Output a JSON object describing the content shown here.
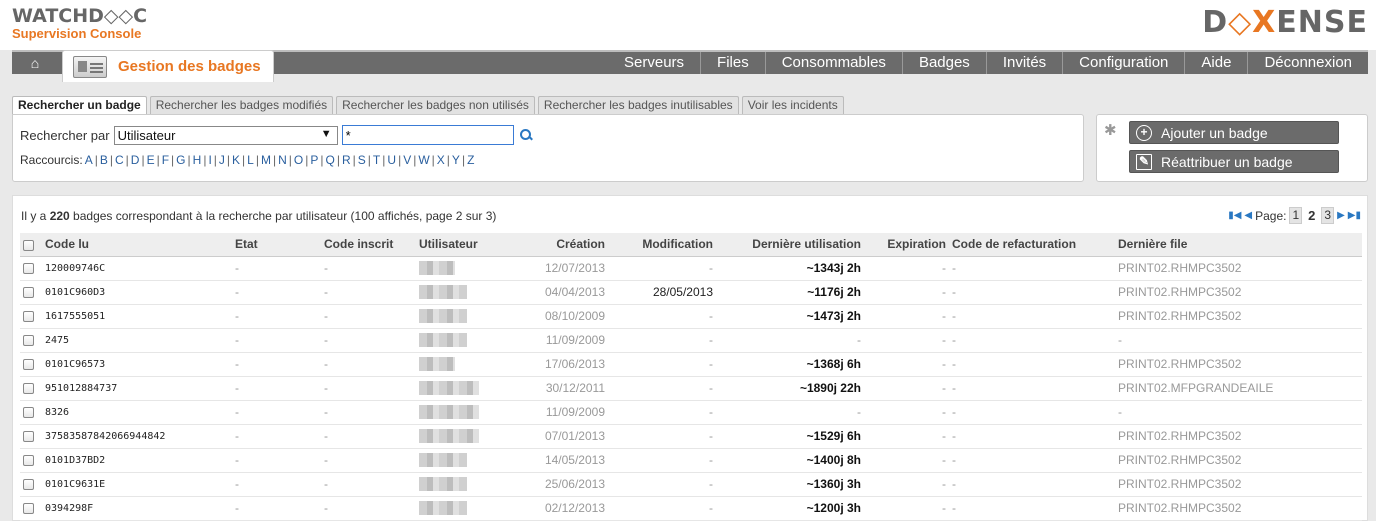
{
  "header": {
    "logo_main": "WATCHD◇◇C",
    "logo_sub": "Supervision Console",
    "brand_pre": "D",
    "brand_accent": "◇X",
    "brand_post": "ENSE"
  },
  "navbar": {
    "home_icon": "home-icon",
    "section_title": "Gestion des badges",
    "menu": [
      "Serveurs",
      "Files",
      "Consommables",
      "Badges",
      "Invités",
      "Configuration",
      "Aide",
      "Déconnexion"
    ]
  },
  "tabs": [
    {
      "label": "Rechercher un badge",
      "active": true
    },
    {
      "label": "Rechercher les badges modifiés",
      "active": false
    },
    {
      "label": "Rechercher les badges non utilisés",
      "active": false
    },
    {
      "label": "Rechercher les badges inutilisables",
      "active": false
    },
    {
      "label": "Voir les incidents",
      "active": false
    }
  ],
  "search": {
    "label": "Rechercher par",
    "select_value": "Utilisateur",
    "input_value": "*",
    "shortcuts_label": "Raccourcis:",
    "letters": [
      "A",
      "B",
      "C",
      "D",
      "E",
      "F",
      "G",
      "H",
      "I",
      "J",
      "K",
      "L",
      "M",
      "N",
      "O",
      "P",
      "Q",
      "R",
      "S",
      "T",
      "U",
      "V",
      "W",
      "X",
      "Y",
      "Z"
    ]
  },
  "actions": {
    "add_badge": "Ajouter un badge",
    "reassign_badge": "Réattribuer un badge"
  },
  "results": {
    "summary_pre": "Il y a ",
    "count": "220",
    "summary_post": " badges correspondant à la recherche par utilisateur (100 affichés, page 2 sur 3)",
    "pager_label": "Page:",
    "pages": [
      "1",
      "2",
      "3"
    ],
    "current_page": "2"
  },
  "table": {
    "headers": [
      "Code lu",
      "Etat",
      "Code inscrit",
      "Utilisateur",
      "Création",
      "Modification",
      "Dernière utilisation",
      "Expiration",
      "Code de refacturation",
      "Dernière file"
    ],
    "rows": [
      {
        "code": "120009746C",
        "etat": "-",
        "inscrit": "-",
        "creation": "12/07/2013",
        "modification": "-",
        "derniere": "~1343j 2h",
        "expiration": "-",
        "refact": "-",
        "file": "PRINT02.RHMPC3502"
      },
      {
        "code": "0101C960D3",
        "etat": "-",
        "inscrit": "-",
        "creation": "04/04/2013",
        "modification": "28/05/2013",
        "derniere": "~1176j 2h",
        "expiration": "-",
        "refact": "-",
        "file": "PRINT02.RHMPC3502"
      },
      {
        "code": "1617555051",
        "etat": "-",
        "inscrit": "-",
        "creation": "08/10/2009",
        "modification": "-",
        "derniere": "~1473j 2h",
        "expiration": "-",
        "refact": "-",
        "file": "PRINT02.RHMPC3502"
      },
      {
        "code": "2475",
        "etat": "-",
        "inscrit": "-",
        "creation": "11/09/2009",
        "modification": "-",
        "derniere": "-",
        "expiration": "-",
        "refact": "-",
        "file": "-"
      },
      {
        "code": "0101C96573",
        "etat": "-",
        "inscrit": "-",
        "creation": "17/06/2013",
        "modification": "-",
        "derniere": "~1368j 6h",
        "expiration": "-",
        "refact": "-",
        "file": "PRINT02.RHMPC3502"
      },
      {
        "code": "951012884737",
        "etat": "-",
        "inscrit": "-",
        "creation": "30/12/2011",
        "modification": "-",
        "derniere": "~1890j 22h",
        "expiration": "-",
        "refact": "-",
        "file": "PRINT02.MFPGRANDEAILE"
      },
      {
        "code": "8326",
        "etat": "-",
        "inscrit": "-",
        "creation": "11/09/2009",
        "modification": "-",
        "derniere": "-",
        "expiration": "-",
        "refact": "-",
        "file": "-"
      },
      {
        "code": "37583587842066944842",
        "etat": "-",
        "inscrit": "-",
        "creation": "07/01/2013",
        "modification": "-",
        "derniere": "~1529j 6h",
        "expiration": "-",
        "refact": "-",
        "file": "PRINT02.RHMPC3502"
      },
      {
        "code": "0101D37BD2",
        "etat": "-",
        "inscrit": "-",
        "creation": "14/05/2013",
        "modification": "-",
        "derniere": "~1400j 8h",
        "expiration": "-",
        "refact": "-",
        "file": "PRINT02.RHMPC3502"
      },
      {
        "code": "0101C9631E",
        "etat": "-",
        "inscrit": "-",
        "creation": "25/06/2013",
        "modification": "-",
        "derniere": "~1360j 3h",
        "expiration": "-",
        "refact": "-",
        "file": "PRINT02.RHMPC3502"
      },
      {
        "code": "0394298F",
        "etat": "-",
        "inscrit": "-",
        "creation": "02/12/2013",
        "modification": "-",
        "derniere": "~1200j 3h",
        "expiration": "-",
        "refact": "-",
        "file": "PRINT02.RHMPC3502"
      }
    ]
  }
}
